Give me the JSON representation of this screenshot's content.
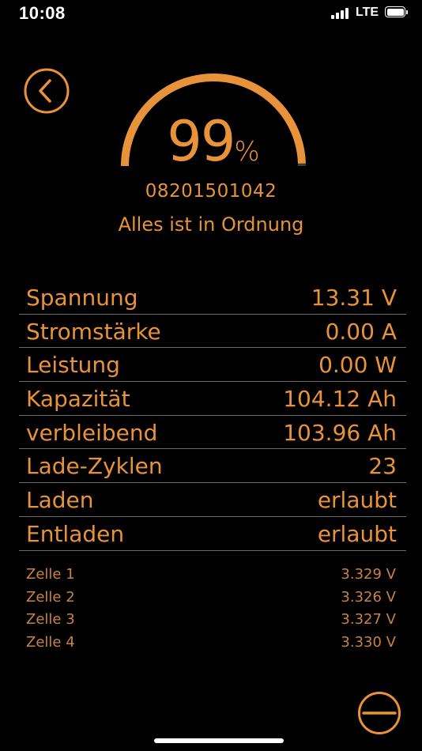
{
  "status_bar": {
    "time": "10:08",
    "network": "LTE"
  },
  "icons": {
    "back": "chevron-left-circle-icon",
    "minus": "minus-circle-icon",
    "signal": "cellular-signal-icon",
    "battery": "battery-icon"
  },
  "colors": {
    "accent": "#e8923a",
    "background": "#000000",
    "divider": "#6a6a6a",
    "cell_text": "#c98245"
  },
  "gauge": {
    "value": "99",
    "unit": "%",
    "fraction": 0.99
  },
  "serial": "08201501042",
  "status_message": "Alles ist in Ordnung",
  "metrics": [
    {
      "label": "Spannung",
      "value": "13.31 V"
    },
    {
      "label": "Stromstärke",
      "value": "0.00 A"
    },
    {
      "label": "Leistung",
      "value": "0.00 W"
    },
    {
      "label": "Kapazität",
      "value": "104.12 Ah"
    },
    {
      "label": "verbleibend",
      "value": "103.96 Ah"
    },
    {
      "label": "Lade-Zyklen",
      "value": "23"
    },
    {
      "label": "Laden",
      "value": "erlaubt"
    },
    {
      "label": "Entladen",
      "value": "erlaubt"
    }
  ],
  "cells": [
    {
      "label": "Zelle 1",
      "value": "3.329 V"
    },
    {
      "label": "Zelle 2",
      "value": "3.326 V"
    },
    {
      "label": "Zelle 3",
      "value": "3.327 V"
    },
    {
      "label": "Zelle 4",
      "value": "3.330 V"
    }
  ]
}
